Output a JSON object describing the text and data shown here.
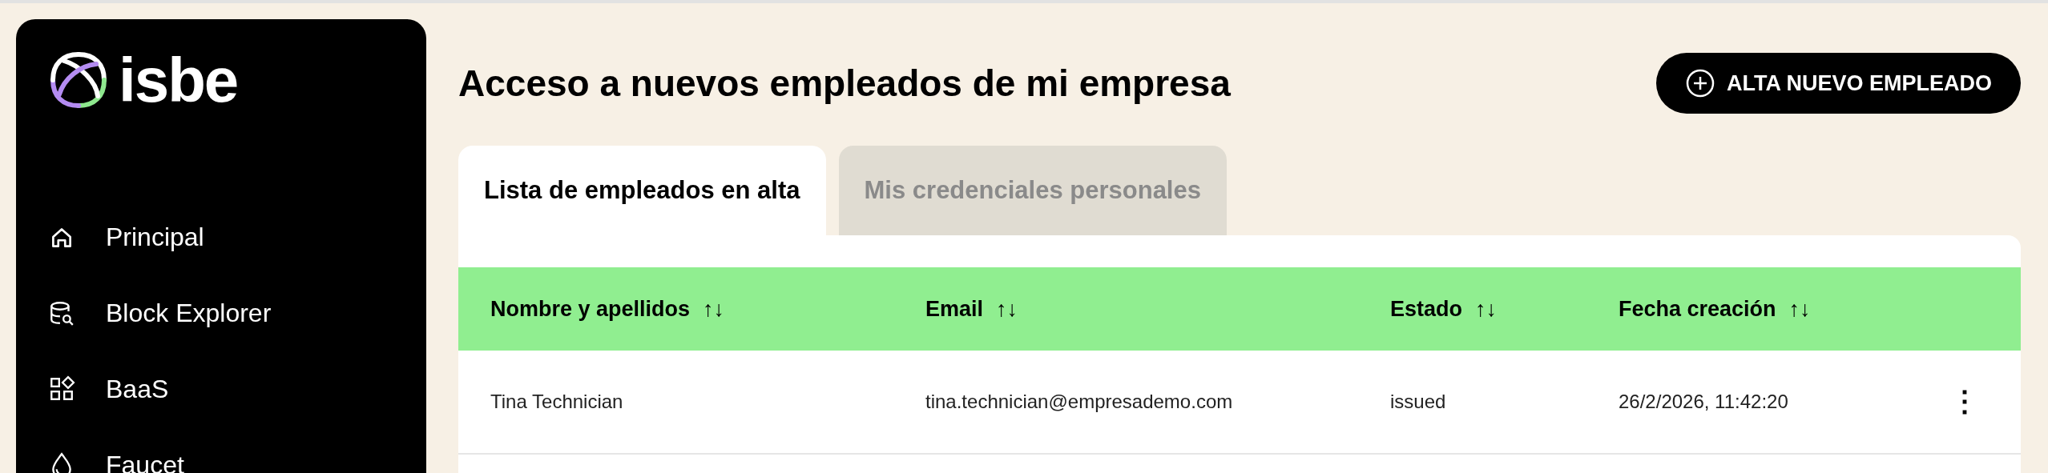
{
  "sidebar": {
    "logo": "isbe",
    "items": [
      {
        "label": "Principal"
      },
      {
        "label": "Block Explorer"
      },
      {
        "label": "BaaS"
      },
      {
        "label": "Faucet"
      }
    ]
  },
  "header": {
    "title": "Acceso a nuevos empleados de mi empresa",
    "action": "ALTA NUEVO EMPLEADO"
  },
  "tabs": [
    {
      "label": "Lista de empleados en alta",
      "selected": true
    },
    {
      "label": "Mis credenciales personales",
      "selected": false
    }
  ],
  "table": {
    "columns": [
      {
        "label": "Nombre y apellidos",
        "sort": "↑↓"
      },
      {
        "label": "Email",
        "sort": "↑↓"
      },
      {
        "label": "Estado",
        "sort": "↑↓"
      },
      {
        "label": "Fecha creación",
        "sort": "↑↓"
      }
    ],
    "rows": [
      {
        "cells": [
          "Tina Technician",
          "tina.technician@empresademo.com",
          "issued",
          "26/2/2026, 11:42:20"
        ],
        "menu": "⋮"
      }
    ]
  }
}
